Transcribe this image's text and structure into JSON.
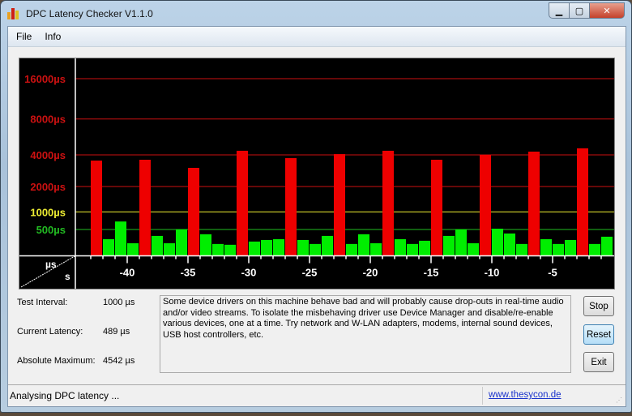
{
  "window": {
    "title": "DPC Latency Checker V1.1.0",
    "icon": "bar-chart-app-icon",
    "controls": [
      "minimize",
      "maximize",
      "close"
    ]
  },
  "menu": {
    "items": [
      "File",
      "Info"
    ]
  },
  "chart_data": {
    "type": "bar",
    "xlabel": "s",
    "ylabel": "µs",
    "y_scale": "log-like (non-linear)",
    "y_gridlines": [
      {
        "label": "16000µs",
        "value": 16000,
        "color": "#cc1111"
      },
      {
        "label": "8000µs",
        "value": 8000,
        "color": "#cc1111"
      },
      {
        "label": "4000µs",
        "value": 4000,
        "color": "#cc1111"
      },
      {
        "label": "2000µs",
        "value": 2000,
        "color": "#cc1111"
      },
      {
        "label": "1000µs",
        "value": 1000,
        "color": "#eeee33"
      },
      {
        "label": "500µs",
        "value": 500,
        "color": "#22bb22"
      }
    ],
    "x_ticks": [
      -40,
      -35,
      -30,
      -25,
      -20,
      -15,
      -10,
      -5
    ],
    "x_tick_labels": [
      "-40",
      "-35",
      "-30",
      "-25",
      "-20",
      "-15",
      "-10",
      "-5"
    ],
    "x": [
      -43,
      -42,
      -41,
      -40,
      -39,
      -38,
      -37,
      -36,
      -35,
      -34,
      -33,
      -32,
      -31,
      -30,
      -29,
      -28,
      -27,
      -26,
      -25,
      -24,
      -23,
      -22,
      -21,
      -20,
      -19,
      -18,
      -17,
      -16,
      -15,
      -14,
      -13,
      -12,
      -11,
      -10,
      -9,
      -8,
      -7,
      -6,
      -5,
      -4,
      -3,
      -2,
      -1
    ],
    "values": [
      3530,
      317,
      685,
      240,
      3595,
      378,
      240,
      500,
      3010,
      410,
      225,
      210,
      4330,
      271,
      301,
      317,
      3725,
      301,
      225,
      378,
      4060,
      225,
      410,
      240,
      4330,
      317,
      225,
      286,
      3595,
      378,
      500,
      240,
      4000,
      516,
      424,
      225,
      4260,
      317,
      225,
      301,
      4542,
      225,
      363
    ],
    "colors": {
      "ok": "#00ee00",
      "bad": "#ee0000",
      "background": "#000000"
    },
    "threshold_bad": 1000,
    "grid": true,
    "legend": "none"
  },
  "stats": {
    "test_interval_label": "Test Interval:",
    "test_interval_value": "1000 µs",
    "current_latency_label": "Current Latency:",
    "current_latency_value": "489 µs",
    "absolute_maximum_label": "Absolute Maximum:",
    "absolute_maximum_value": "4542 µs"
  },
  "message": "Some device drivers on this machine behave bad and will probably cause drop-outs in real-time audio and/or video streams. To isolate the misbehaving driver use Device Manager and disable/re-enable various devices, one at a time. Try network and W-LAN adapters, modems, internal sound devices, USB host controllers, etc.",
  "buttons": {
    "stop": "Stop",
    "reset": "Reset",
    "exit": "Exit"
  },
  "status": {
    "text": "Analysing DPC latency ...",
    "link": "www.thesycon.de"
  }
}
